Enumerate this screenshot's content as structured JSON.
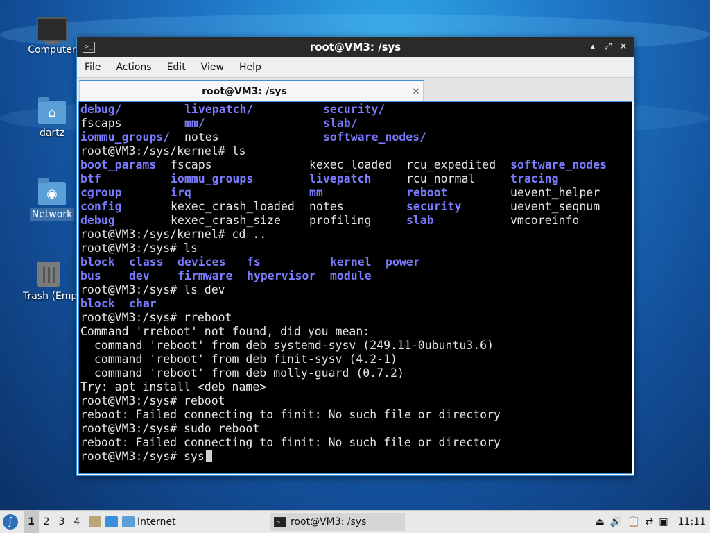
{
  "desktop": {
    "icons": [
      {
        "label": "Computer",
        "icon": "computer-icon"
      },
      {
        "label": "dartz",
        "icon": "home-folder-icon"
      },
      {
        "label": "Network",
        "icon": "network-folder-icon"
      },
      {
        "label": "Trash (Empty)",
        "icon": "trash-icon"
      }
    ]
  },
  "window": {
    "title": "root@VM3: /sys",
    "menu": [
      "File",
      "Actions",
      "Edit",
      "View",
      "Help"
    ],
    "tab_label": "root@VM3: /sys",
    "controls": {
      "minimize": "▴",
      "maximize": "⤢",
      "close": "✕"
    }
  },
  "terminal": {
    "dir_color": "#7b7bff",
    "text_color": "#e6e6e6",
    "lines": [
      [
        [
          "debug/",
          0,
          "dir"
        ],
        [
          "livepatch/",
          15,
          "dir"
        ],
        [
          "security/",
          35,
          "dir"
        ]
      ],
      [
        [
          "fscaps",
          0,
          ""
        ],
        [
          "mm/",
          15,
          "dir"
        ],
        [
          "slab/",
          35,
          "dir"
        ]
      ],
      [
        [
          "iommu_groups/",
          0,
          "dir"
        ],
        [
          "notes",
          15,
          ""
        ],
        [
          "software_nodes/",
          35,
          "dir"
        ]
      ],
      [
        [
          "root@VM3:/sys/kernel# ls",
          0,
          ""
        ]
      ],
      [
        [
          "boot_params",
          0,
          "dir"
        ],
        [
          "fscaps",
          13,
          ""
        ],
        [
          "kexec_loaded",
          33,
          ""
        ],
        [
          "rcu_expedited",
          47,
          ""
        ],
        [
          "software_nodes",
          62,
          "dir"
        ]
      ],
      [
        [
          "btf",
          0,
          "dir"
        ],
        [
          "iommu_groups",
          13,
          "dir"
        ],
        [
          "livepatch",
          33,
          "dir"
        ],
        [
          "rcu_normal",
          47,
          ""
        ],
        [
          "tracing",
          62,
          "dir"
        ]
      ],
      [
        [
          "cgroup",
          0,
          "dir"
        ],
        [
          "irq",
          13,
          "dir"
        ],
        [
          "mm",
          33,
          "dir"
        ],
        [
          "reboot",
          47,
          "dir"
        ],
        [
          "uevent_helper",
          62,
          ""
        ]
      ],
      [
        [
          "config",
          0,
          "dir"
        ],
        [
          "kexec_crash_loaded",
          13,
          ""
        ],
        [
          "notes",
          33,
          ""
        ],
        [
          "security",
          47,
          "dir"
        ],
        [
          "uevent_seqnum",
          62,
          ""
        ]
      ],
      [
        [
          "debug",
          0,
          "dir"
        ],
        [
          "kexec_crash_size",
          13,
          ""
        ],
        [
          "profiling",
          33,
          ""
        ],
        [
          "slab",
          47,
          "dir"
        ],
        [
          "vmcoreinfo",
          62,
          ""
        ]
      ],
      [
        [
          "root@VM3:/sys/kernel# cd ..",
          0,
          ""
        ]
      ],
      [
        [
          "root@VM3:/sys# ls",
          0,
          ""
        ]
      ],
      [
        [
          "block",
          0,
          "dir"
        ],
        [
          "class",
          7,
          "dir"
        ],
        [
          "devices",
          14,
          "dir"
        ],
        [
          "fs",
          24,
          "dir"
        ],
        [
          "kernel",
          36,
          "dir"
        ],
        [
          "power",
          44,
          "dir"
        ]
      ],
      [
        [
          "bus",
          0,
          "dir"
        ],
        [
          "dev",
          7,
          "dir"
        ],
        [
          "firmware",
          14,
          "dir"
        ],
        [
          "hypervisor",
          24,
          "dir"
        ],
        [
          "module",
          36,
          "dir"
        ]
      ],
      [
        [
          "root@VM3:/sys# ls dev",
          0,
          ""
        ]
      ],
      [
        [
          "block",
          0,
          "dir"
        ],
        [
          "char",
          7,
          "dir"
        ]
      ],
      [
        [
          "root@VM3:/sys# rreboot",
          0,
          ""
        ]
      ],
      [
        [
          "Command 'rreboot' not found, did you mean:",
          0,
          ""
        ]
      ],
      [
        [
          "  command 'reboot' from deb systemd-sysv (249.11-0ubuntu3.6)",
          0,
          ""
        ]
      ],
      [
        [
          "  command 'reboot' from deb finit-sysv (4.2-1)",
          0,
          ""
        ]
      ],
      [
        [
          "  command 'reboot' from deb molly-guard (0.7.2)",
          0,
          ""
        ]
      ],
      [
        [
          "Try: apt install <deb name>",
          0,
          ""
        ]
      ],
      [
        [
          "root@VM3:/sys# reboot",
          0,
          ""
        ]
      ],
      [
        [
          "reboot: Failed connecting to finit: No such file or directory",
          0,
          ""
        ]
      ],
      [
        [
          "root@VM3:/sys# sudo reboot",
          0,
          ""
        ]
      ],
      [
        [
          "reboot: Failed connecting to finit: No such file or directory",
          0,
          ""
        ]
      ],
      [
        [
          "root@VM3:/sys# sys",
          0,
          ""
        ]
      ]
    ]
  },
  "taskbar": {
    "workspaces": [
      "1",
      "2",
      "3",
      "4"
    ],
    "active_workspace": "1",
    "folder_label": "Internet",
    "task_label": "root@VM3: /sys",
    "clock": "11:11"
  }
}
